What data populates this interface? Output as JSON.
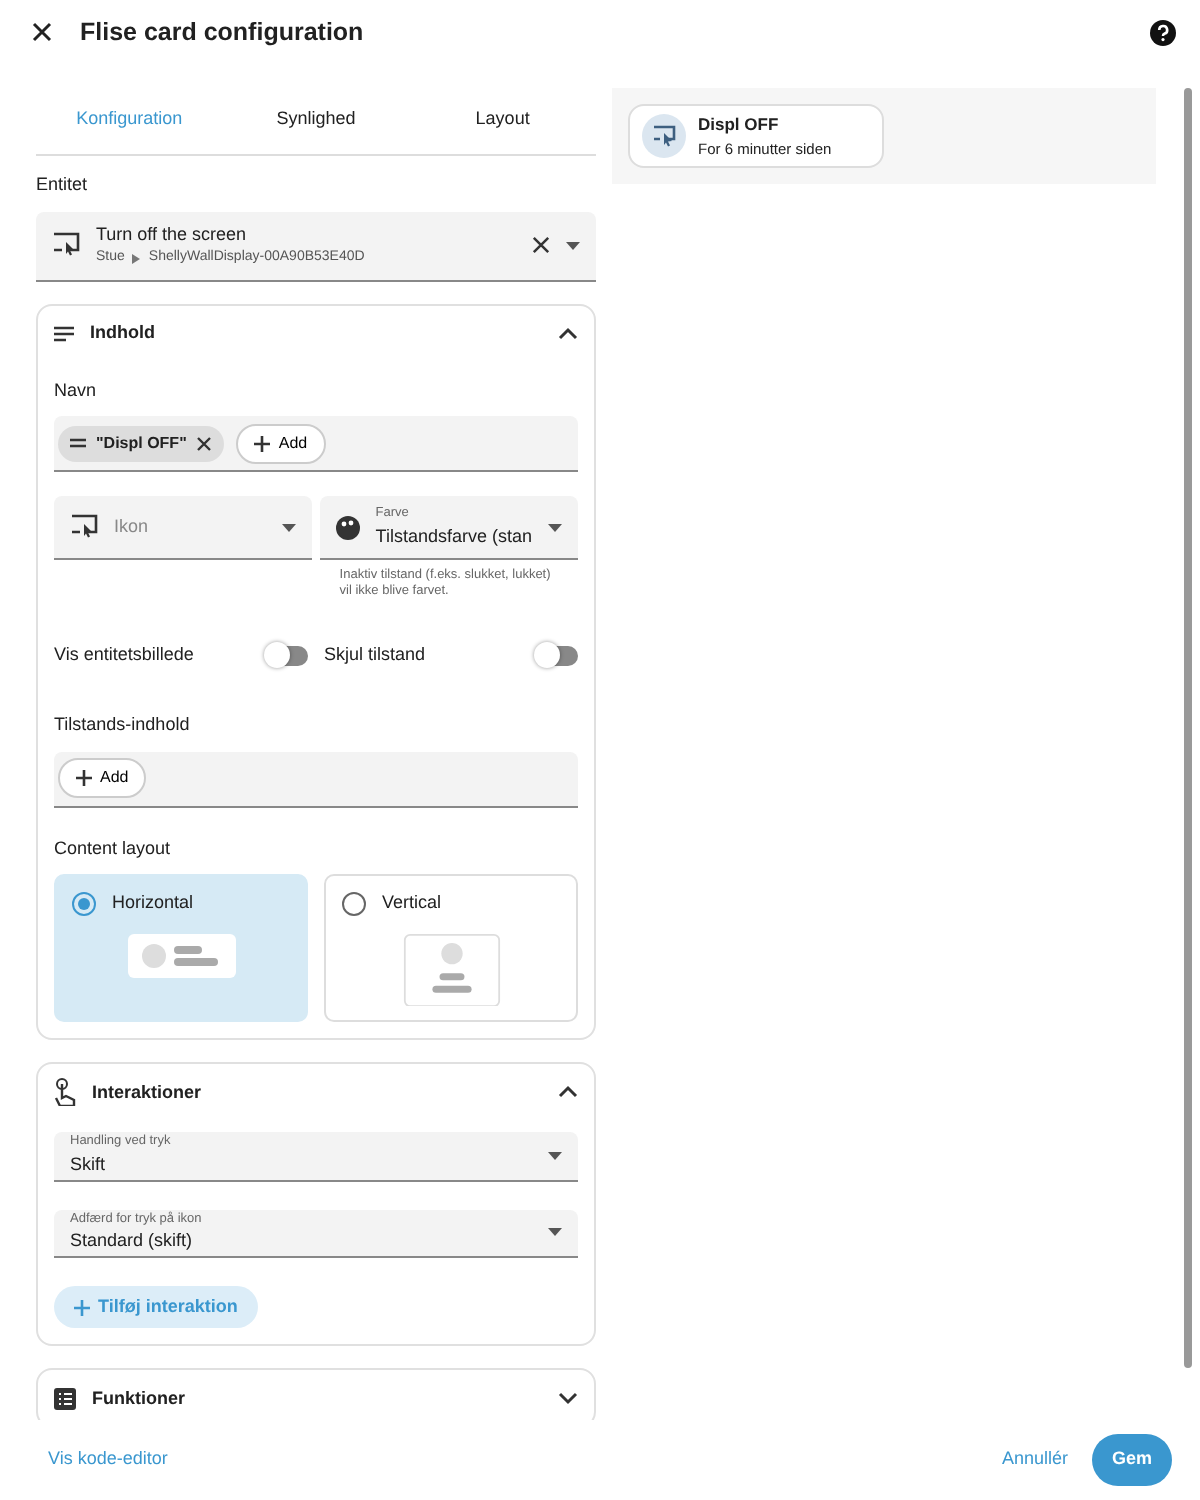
{
  "dialog": {
    "title": "Flise card configuration"
  },
  "tabs": [
    {
      "label": "Konfiguration",
      "selected": true
    },
    {
      "label": "Synlighed",
      "selected": false
    },
    {
      "label": "Layout",
      "selected": false
    }
  ],
  "entity": {
    "label": "Entitet",
    "name": "Turn off the screen",
    "area": "Stue",
    "device": "ShellyWallDisplay-00A90B53E40D"
  },
  "content": {
    "title": "Indhold",
    "expanded": true,
    "name_label": "Navn",
    "name_chips": [
      "\"Displ OFF\""
    ],
    "add_label": "Add",
    "icon_field": {
      "placeholder": "Ikon"
    },
    "color_field": {
      "label": "Farve",
      "value": "Tilstandsfarve (stan",
      "hint": "Inaktiv tilstand (f.eks. slukket, lukket) vil ikke blive farvet."
    },
    "toggles": [
      {
        "label": "Vis entitetsbillede",
        "on": false
      },
      {
        "label": "Skjul tilstand",
        "on": false
      }
    ],
    "state_content_label": "Tilstands-indhold",
    "state_add_label": "Add",
    "layout_label": "Content layout",
    "layouts": [
      {
        "label": "Horizontal",
        "kind": "horizontal",
        "selected": true
      },
      {
        "label": "Vertical",
        "kind": "vertical",
        "selected": false
      }
    ]
  },
  "interactions": {
    "title": "Interaktioner",
    "expanded": true,
    "fields": [
      {
        "label": "Handling ved tryk",
        "value": "Skift"
      },
      {
        "label": "Adfærd for tryk på ikon",
        "value": "Standard (skift)"
      }
    ],
    "add_button": "Tilføj interaktion"
  },
  "features": {
    "title": "Funktioner",
    "expanded": false
  },
  "preview": {
    "name": "Displ OFF",
    "state": "For 6 minutter siden"
  },
  "footer": {
    "code_link": "Vis kode-editor",
    "cancel": "Annullér",
    "save": "Gem"
  }
}
